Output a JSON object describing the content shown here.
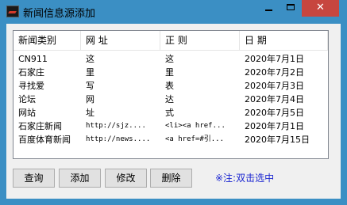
{
  "window": {
    "title": "新闻信息源添加",
    "close_glyph": "✕"
  },
  "table": {
    "headers": [
      "新闻类别",
      "网    址",
      "正    则",
      "日    期"
    ],
    "rows": [
      [
        "CN911",
        "这",
        "这",
        "2020年7月1日"
      ],
      [
        "石家庄",
        "里",
        "里",
        "2020年7月2日"
      ],
      [
        "寻找爱",
        "写",
        "表",
        "2020年7月3日"
      ],
      [
        "论坛",
        "网",
        "达",
        "2020年7月4日"
      ],
      [
        "网站",
        "址",
        "式",
        "2020年7月5日"
      ],
      [
        "石家庄新闻",
        "http://sjz....",
        "<li><a href...",
        "2020年7月1日"
      ],
      [
        "百度体育新闻",
        "http://news....",
        "<a href=#引...",
        "2020年7月15日"
      ]
    ]
  },
  "buttons": {
    "query": "查询",
    "add": "添加",
    "modify": "修改",
    "delete": "删除"
  },
  "note": "※注:双击选中",
  "colors": {
    "titlebar": "#3b8fc4",
    "close": "#c7463f",
    "note": "#1a25d1"
  }
}
